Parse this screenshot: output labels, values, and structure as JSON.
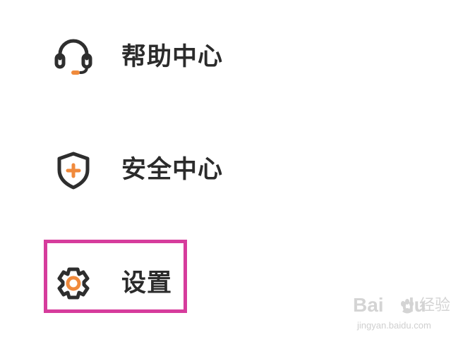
{
  "menu": {
    "items": [
      {
        "label": "帮助中心",
        "icon": "headset-icon"
      },
      {
        "label": "安全中心",
        "icon": "shield-plus-icon"
      },
      {
        "label": "设置",
        "icon": "gear-icon"
      }
    ]
  },
  "colors": {
    "text": "#2b2b2b",
    "icon_stroke": "#2e2e2e",
    "accent": "#f08a3c",
    "highlight": "#d63c9c",
    "watermark": "#d4d4d4"
  },
  "watermark": {
    "logo": "Bai",
    "logo_suffix": "du",
    "sub": "经验",
    "url": "jingyan.baidu.com"
  }
}
